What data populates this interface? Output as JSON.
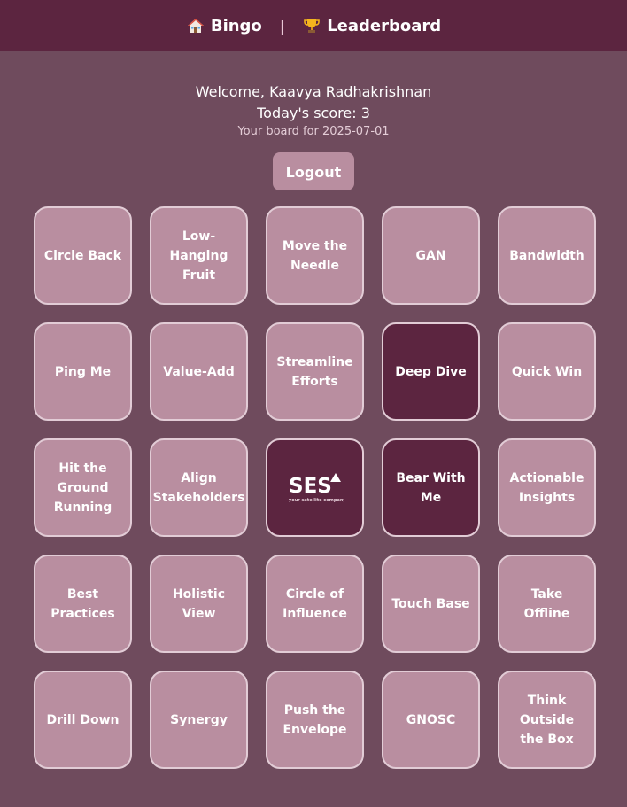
{
  "nav": {
    "bingo_label": "Bingo",
    "separator": "|",
    "leaderboard_label": "Leaderboard"
  },
  "user": {
    "welcome": "Welcome, Kaavya Radhakrishnan",
    "score": "Today's score: 3",
    "board_date": "Your board for 2025-07-01"
  },
  "actions": {
    "logout_label": "Logout"
  },
  "board": {
    "tiles": [
      {
        "label": "Circle Back",
        "marked": false
      },
      {
        "label": "Low-Hanging Fruit",
        "marked": false
      },
      {
        "label": "Move the Needle",
        "marked": false
      },
      {
        "label": "GAN",
        "marked": false
      },
      {
        "label": "Bandwidth",
        "marked": false
      },
      {
        "label": "Ping Me",
        "marked": false
      },
      {
        "label": "Value-Add",
        "marked": false
      },
      {
        "label": "Streamline Efforts",
        "marked": false
      },
      {
        "label": "Deep Dive",
        "marked": true
      },
      {
        "label": "Quick Win",
        "marked": false
      },
      {
        "label": "Hit the Ground Running",
        "marked": false
      },
      {
        "label": "Align Stakeholders",
        "marked": false
      },
      {
        "label": "SES",
        "marked": true,
        "logo": true,
        "logo_tagline": "your satellite company"
      },
      {
        "label": "Bear With Me",
        "marked": true
      },
      {
        "label": "Actionable Insights",
        "marked": false
      },
      {
        "label": "Best Practices",
        "marked": false
      },
      {
        "label": "Holistic View",
        "marked": false
      },
      {
        "label": "Circle of Influence",
        "marked": false
      },
      {
        "label": "Touch Base",
        "marked": false
      },
      {
        "label": "Take Offline",
        "marked": false
      },
      {
        "label": "Drill Down",
        "marked": false
      },
      {
        "label": "Synergy",
        "marked": false
      },
      {
        "label": "Push the Envelope",
        "marked": false
      },
      {
        "label": "GNOSC",
        "marked": false
      },
      {
        "label": "Think Outside the Box",
        "marked": false
      }
    ]
  },
  "colors": {
    "background": "#6f4b5d",
    "header": "#5c2540",
    "tile": "#b98ea0",
    "tile_marked": "#5c2540",
    "tile_border": "#e2ccd6"
  },
  "icons": {
    "bingo": "house-icon",
    "leaderboard": "trophy-icon"
  }
}
